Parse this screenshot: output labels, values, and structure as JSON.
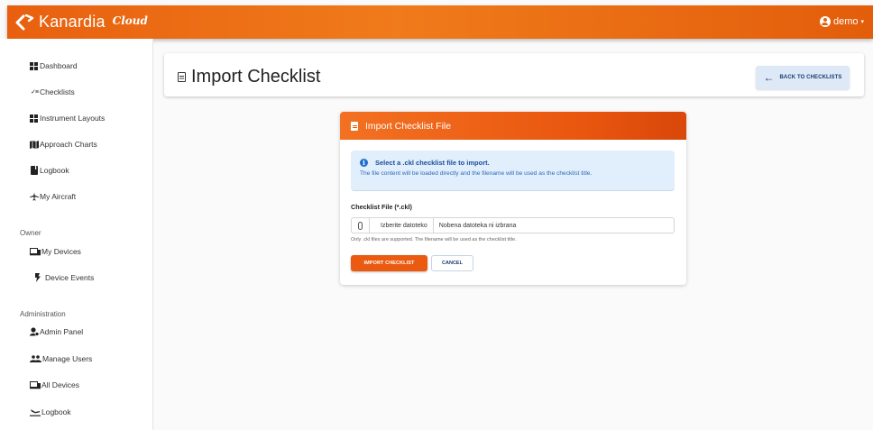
{
  "app": {
    "brand": "Kanardia",
    "brand_suffix": "Cloud",
    "user": "demo",
    "user_caret": "▾"
  },
  "sidebar": {
    "items": [
      {
        "label": "Dashboard",
        "icon": "dashboard-icon"
      },
      {
        "label": "Checklists",
        "icon": "checklist-icon"
      },
      {
        "label": "Instrument Layouts",
        "icon": "layout-icon"
      },
      {
        "label": "Approach Charts",
        "icon": "map-icon"
      },
      {
        "label": "Logbook",
        "icon": "book-icon"
      },
      {
        "label": "My Aircraft",
        "icon": "airplane-icon"
      }
    ],
    "owner_title": "Owner",
    "owner_items": [
      {
        "label": "My Devices",
        "icon": "devices-icon"
      },
      {
        "label": "Device Events",
        "icon": "bolt-icon"
      }
    ],
    "admin_title": "Administration",
    "admin_items": [
      {
        "label": "Admin Panel",
        "icon": "admin-icon"
      },
      {
        "label": "Manage Users",
        "icon": "users-icon"
      },
      {
        "label": "All Devices",
        "icon": "devices-icon"
      },
      {
        "label": "Logbook",
        "icon": "flight-log-icon"
      }
    ]
  },
  "header": {
    "title": "Import Checklist",
    "back_label": "BACK TO CHECKLISTS",
    "back_arrow": "←"
  },
  "card": {
    "title": "Import Checklist File",
    "info_title": "Select a .ckl checklist file to import.",
    "info_text": "The file content will be loaded directly and the filename will be used as the checklist title.",
    "field_label": "Checklist File (*.ckl)",
    "choose_label": "Izberite datoteko",
    "file_name": "Nobena datoteka ni izbrana",
    "hint": "Only .ckl files are supported. The filename will be used as the checklist title.",
    "import_label": "IMPORT CHECKLIST",
    "cancel_label": "CANCEL"
  },
  "colors": {
    "accent": "#ea5a10",
    "info_bg": "#e1eefb",
    "info_text": "#2e6ab8"
  }
}
